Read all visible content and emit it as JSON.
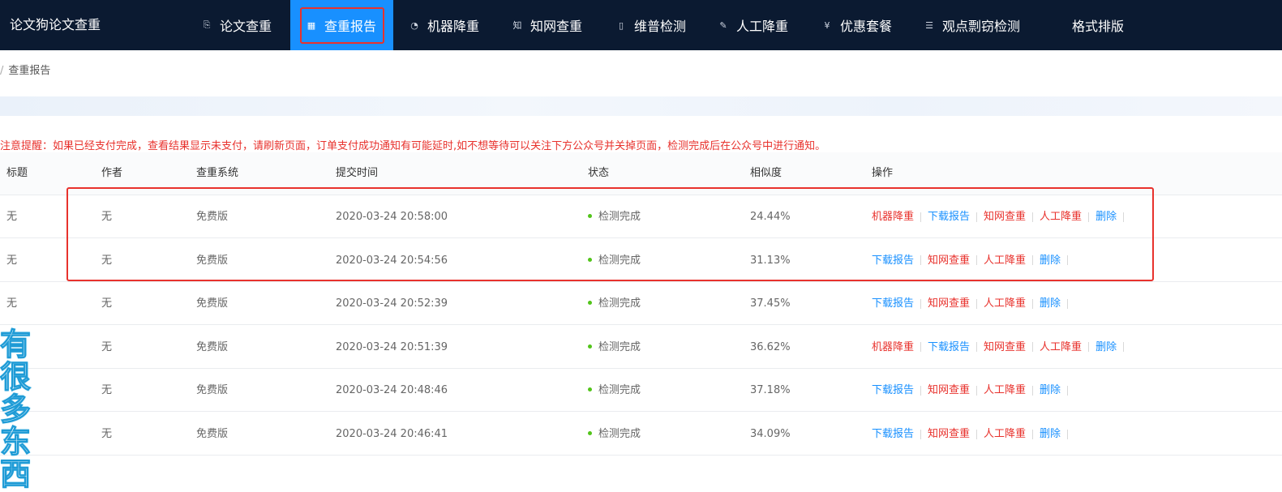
{
  "brand": "论文狗论文查重",
  "nav": [
    {
      "label": "论文查重",
      "icon": "document-search-icon",
      "glyph": "⎘"
    },
    {
      "label": "查重报告",
      "icon": "calendar-icon",
      "glyph": "▦",
      "active": true
    },
    {
      "label": "机器降重",
      "icon": "robot-icon",
      "glyph": "◔"
    },
    {
      "label": "知网查重",
      "icon": "zhi-character-icon",
      "glyph": "知"
    },
    {
      "label": "维普检测",
      "icon": "file-icon",
      "glyph": "▯"
    },
    {
      "label": "人工降重",
      "icon": "hand-edit-icon",
      "glyph": "✎"
    },
    {
      "label": "优惠套餐",
      "icon": "yen-circle-icon",
      "glyph": "¥"
    },
    {
      "label": "观点剽窃检测",
      "icon": "list-icon",
      "glyph": "☰"
    },
    {
      "label": "格式排版",
      "icon": "",
      "glyph": ""
    }
  ],
  "breadcrumb": {
    "sep": "/",
    "current": "查重报告"
  },
  "notice": "注意提醒：如果已经支付完成，查看结果显示未支付，请刷新页面，订单支付成功通知有可能延时,如不想等待可以关注下方公众号并关掉页面，检测完成后在公众号中进行通知。",
  "table": {
    "headers": [
      "标题",
      "作者",
      "查重系统",
      "提交时间",
      "状态",
      "相似度",
      "操作"
    ],
    "rows": [
      {
        "title": "无",
        "author": "无",
        "system": "免费版",
        "time": "2020-03-24 20:58:00",
        "status": "检测完成",
        "similarity": "24.44%",
        "ops": [
          {
            "label": "机器降重",
            "color": "red"
          },
          {
            "label": "下载报告",
            "color": "blue"
          },
          {
            "label": "知网查重",
            "color": "red"
          },
          {
            "label": "人工降重",
            "color": "red"
          },
          {
            "label": "删除",
            "color": "blue"
          }
        ]
      },
      {
        "title": "无",
        "author": "无",
        "system": "免费版",
        "time": "2020-03-24 20:54:56",
        "status": "检测完成",
        "similarity": "31.13%",
        "ops": [
          {
            "label": "下载报告",
            "color": "blue"
          },
          {
            "label": "知网查重",
            "color": "red"
          },
          {
            "label": "人工降重",
            "color": "red"
          },
          {
            "label": "删除",
            "color": "blue"
          }
        ]
      },
      {
        "title": "无",
        "author": "无",
        "system": "免费版",
        "time": "2020-03-24 20:52:39",
        "status": "检测完成",
        "similarity": "37.45%",
        "ops": [
          {
            "label": "下载报告",
            "color": "blue"
          },
          {
            "label": "知网查重",
            "color": "red"
          },
          {
            "label": "人工降重",
            "color": "red"
          },
          {
            "label": "删除",
            "color": "blue"
          }
        ]
      },
      {
        "title": "",
        "author": "无",
        "system": "免费版",
        "time": "2020-03-24 20:51:39",
        "status": "检测完成",
        "similarity": "36.62%",
        "ops": [
          {
            "label": "机器降重",
            "color": "red"
          },
          {
            "label": "下载报告",
            "color": "blue"
          },
          {
            "label": "知网查重",
            "color": "red"
          },
          {
            "label": "人工降重",
            "color": "red"
          },
          {
            "label": "删除",
            "color": "blue"
          }
        ]
      },
      {
        "title": "",
        "author": "无",
        "system": "免费版",
        "time": "2020-03-24 20:48:46",
        "status": "检测完成",
        "similarity": "37.18%",
        "ops": [
          {
            "label": "下载报告",
            "color": "blue"
          },
          {
            "label": "知网查重",
            "color": "red"
          },
          {
            "label": "人工降重",
            "color": "red"
          },
          {
            "label": "删除",
            "color": "blue"
          }
        ]
      },
      {
        "title": "",
        "author": "无",
        "system": "免费版",
        "time": "2020-03-24 20:46:41",
        "status": "检测完成",
        "similarity": "34.09%",
        "ops": [
          {
            "label": "下载报告",
            "color": "blue"
          },
          {
            "label": "知网查重",
            "color": "red"
          },
          {
            "label": "人工降重",
            "color": "red"
          },
          {
            "label": "删除",
            "color": "blue"
          }
        ]
      }
    ]
  },
  "overlay_text": "有很多东西",
  "colors": {
    "nav_bg": "#0b1a31",
    "active": "#1890ff",
    "red": "#e8322d",
    "blue": "#1890ff",
    "status_green": "#52c41a"
  }
}
